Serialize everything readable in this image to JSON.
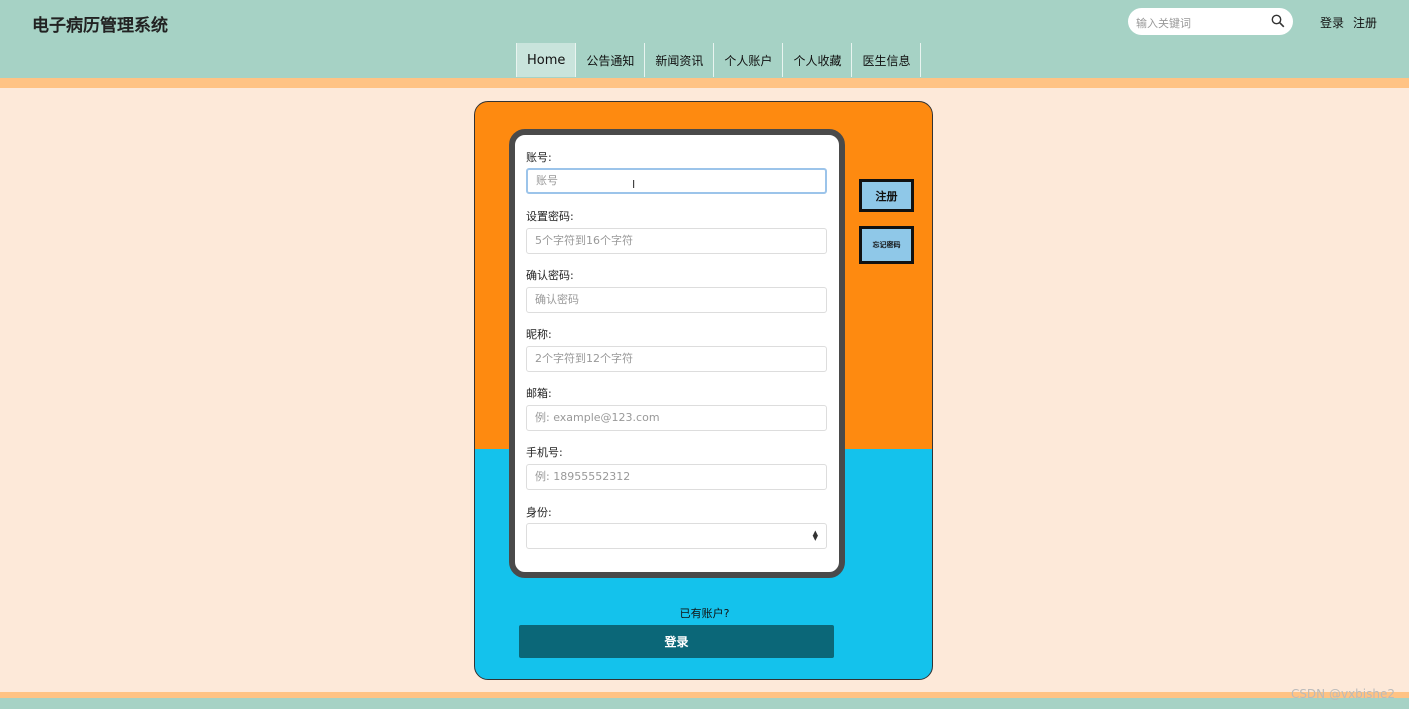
{
  "app": {
    "title": "电子病历管理系统"
  },
  "search": {
    "placeholder": "输入关键词",
    "icon": "search-icon"
  },
  "top_links": {
    "login": "登录",
    "register": "注册"
  },
  "nav": {
    "items": [
      {
        "label": "Home",
        "active": true
      },
      {
        "label": "公告通知"
      },
      {
        "label": "新闻资讯"
      },
      {
        "label": "个人账户"
      },
      {
        "label": "个人收藏"
      },
      {
        "label": "医生信息"
      }
    ]
  },
  "form": {
    "fields": [
      {
        "label": "账号:",
        "placeholder": "账号"
      },
      {
        "label": "设置密码:",
        "placeholder": "5个字符到16个字符"
      },
      {
        "label": "确认密码:",
        "placeholder": "确认密码"
      },
      {
        "label": "昵称:",
        "placeholder": "2个字符到12个字符"
      },
      {
        "label": "邮箱:",
        "placeholder": "例: example@123.com"
      },
      {
        "label": "手机号:",
        "placeholder": "例: 18955552312"
      },
      {
        "label": "身份:",
        "value": ""
      }
    ]
  },
  "side_buttons": {
    "register": "注册",
    "forgot_password": "忘记密码"
  },
  "have_account": "已有账户?",
  "login_button": "登录",
  "watermark": "CSDN @vxbishe2",
  "colors": {
    "header": "#a6d2c5",
    "accent_stripe": "#ffc384",
    "page_bg": "#fde9d9",
    "card_top": "#fe8a10",
    "card_bottom": "#14c2ec",
    "login_button": "#0b6778",
    "side_button": "#8fc8e8"
  }
}
